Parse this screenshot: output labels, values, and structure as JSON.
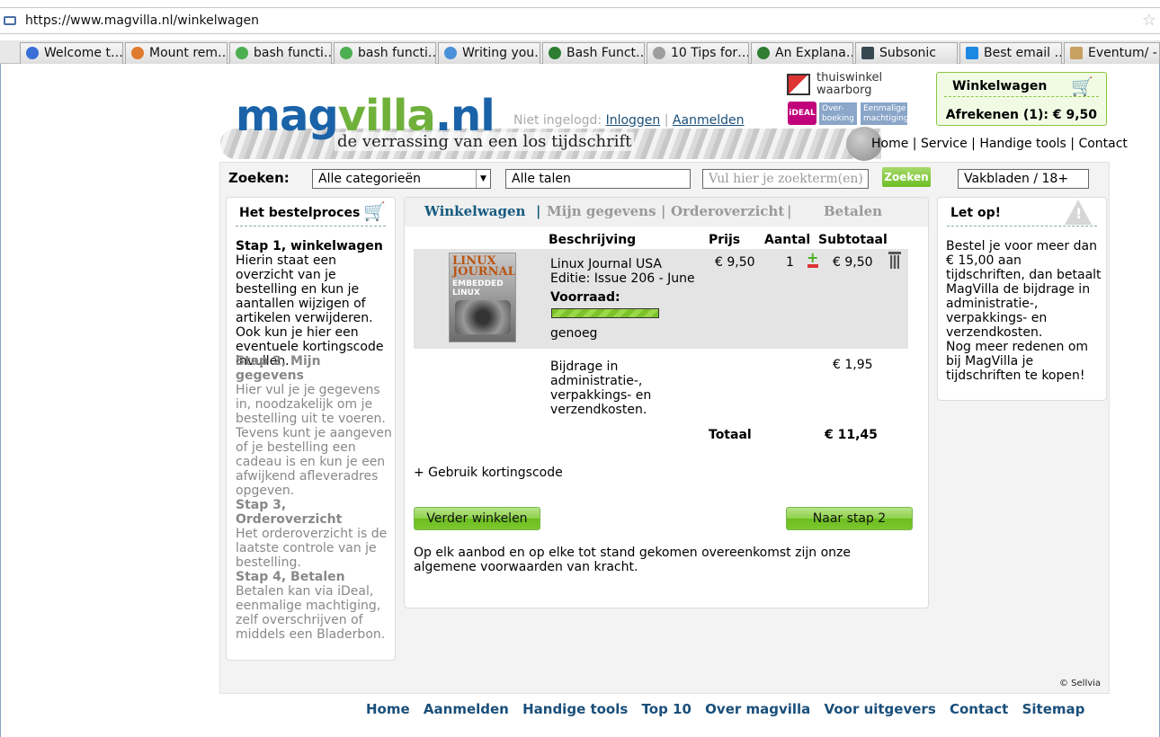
{
  "browser": {
    "url": "https://www.magvilla.nl/winkelwagen",
    "tabs": [
      "Welcome t…",
      "Mount rem…",
      "bash functi…",
      "bash functi…",
      "Writing you…",
      "Bash Funct…",
      "10 Tips for…",
      "An Explana…",
      "Subsonic",
      "Best email …",
      "Eventum/ - …"
    ]
  },
  "header": {
    "logo": {
      "mag": "mag",
      "villa": "villa",
      "nl": ".nl"
    },
    "tagline": "de verrassing van een los tijdschrift",
    "not_logged_in": "Niet ingelogd:",
    "login": "Inloggen",
    "login_sep": "|",
    "register": "Aanmelden",
    "thuiswinkel": "thuiswinkel waarborg",
    "ideal": "iDEAL",
    "badge_transfer": "Over-boeking",
    "badge_mandate": "Eenmalige machtiging",
    "cart_title": "Winkelwagen",
    "cart_checkout": "Afrekenen (1): € 9,50",
    "topnav": "Home | Service | Handige tools | Contact"
  },
  "search": {
    "label": "Zoeken:",
    "category": "Alle categorieën",
    "language": "Alle talen",
    "placeholder": "Vul hier je zoekterm(en)",
    "button": "Zoeken",
    "filter": "Vakbladen / 18+"
  },
  "left": {
    "title": "Het bestelproces",
    "steps": [
      {
        "title": "Stap 1, winkelwagen",
        "desc": "Hierin staat een overzicht van je bestelling en kun je aantallen wijzigen of artikelen verwijderen. Ook kun je hier een eventuele kortingscode invullen."
      },
      {
        "title": "Stap 2, Mijn gegevens",
        "desc": "Hier vul je je gegevens in, noodzakelijk om je bestelling uit te voeren. Tevens kunt je aangeven of je bestelling een cadeau is en kun je een afwijkend afleveradres opgeven."
      },
      {
        "title": "Stap 3, Orderoverzicht",
        "desc": "Het orderoverzicht is de laatste controle van je bestelling."
      },
      {
        "title": "Stap 4, Betalen",
        "desc": "Betalen kan via iDeal, eenmalige machtiging, zelf overschrijven of middels een Bladerbon."
      }
    ]
  },
  "main": {
    "tabs": [
      "Winkelwagen",
      "Mijn gegevens",
      "Orderoverzicht",
      "Betalen"
    ],
    "sep": "|",
    "headers": [
      "Beschrijving",
      "Prijs",
      "Aantal",
      "Subtotaal"
    ],
    "item": {
      "cover_title": "LINUX JOURNAL",
      "cover_sub": "EMBEDDED LINUX",
      "name": "Linux Journal USA",
      "edition": "Editie: Issue 206 - June",
      "stock_label": "Voorraad:",
      "stock_level": 1.0,
      "stock_text": "genoeg",
      "price": "€ 9,50",
      "qty": "1",
      "subtotal": "€ 9,50"
    },
    "fee": {
      "desc": "Bijdrage in administratie-, verpakkings- en verzendkosten.",
      "amount": "€ 1,95"
    },
    "total_label": "Totaal",
    "total": "€ 11,45",
    "coupon": "+ Gebruik kortingscode",
    "btn_continue": "Verder winkelen",
    "btn_next": "Naar stap 2",
    "terms": "Op elk aanbod en op elke tot stand gekomen overeenkomst zijn onze algemene voorwaarden van kracht."
  },
  "right": {
    "title": "Let op!",
    "p1": "Bestel je voor meer dan € 15,00 aan tijdschriften, dan betaalt MagVilla de bijdrage in administratie-, verpakkings- en verzendkosten.",
    "p2": "Nog meer redenen om bij MagVilla je tijdschriften te kopen!"
  },
  "footer": {
    "sellvia": "© Sellvia",
    "links": [
      "Home",
      "Aanmelden",
      "Handige tools",
      "Top 10",
      "Over magvilla",
      "Voor uitgevers",
      "Contact",
      "Sitemap"
    ]
  }
}
